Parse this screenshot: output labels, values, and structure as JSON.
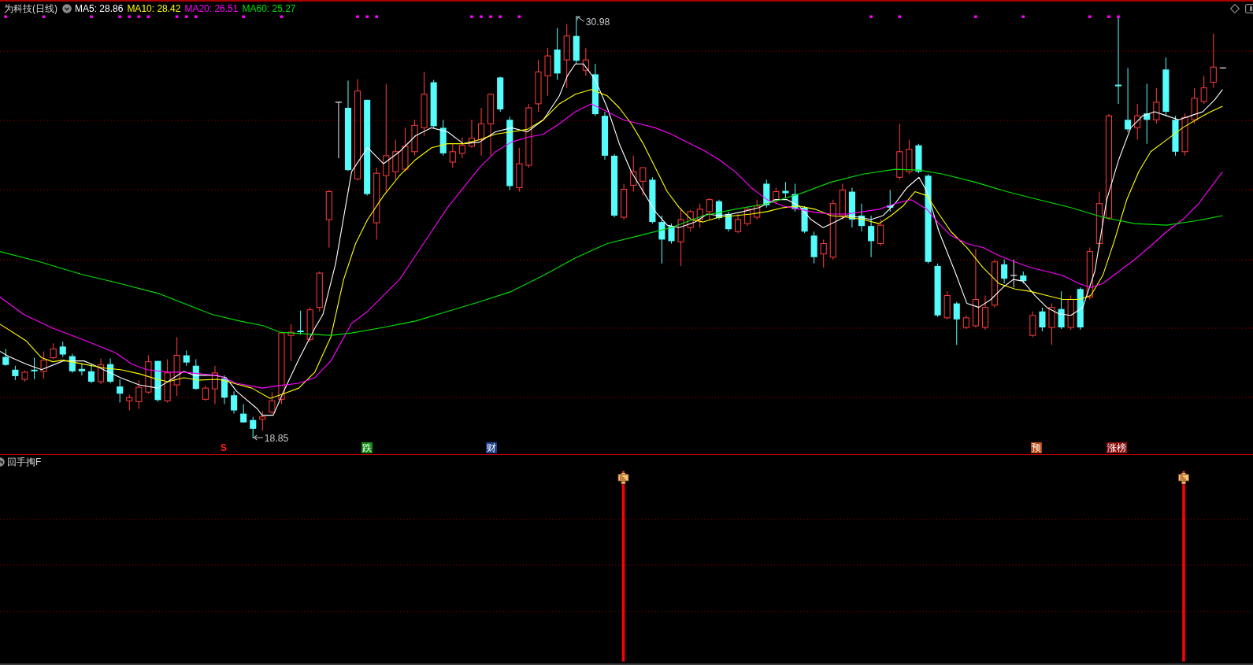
{
  "chart_header": {
    "title": "为科技(日线)",
    "indicators": [
      {
        "label": "MA5: 28.86",
        "color": "#ffffff"
      },
      {
        "label": "MA10: 28.42",
        "color": "#ffff00"
      },
      {
        "label": "MA20: 26.51",
        "color": "#ff00ff"
      },
      {
        "label": "MA60: 25.27",
        "color": "#00e000"
      }
    ]
  },
  "price_chart": {
    "high_label": "30.98",
    "low_label": "18.85",
    "signal_tags": [
      {
        "text": "S",
        "kind": "text",
        "color": "#ff2020"
      },
      {
        "text": "跌",
        "kind": "tag",
        "color": "#138a13"
      },
      {
        "text": "财",
        "kind": "tag",
        "color": "#1c3f8c"
      },
      {
        "text": "预",
        "kind": "tag",
        "color": "#b4470e"
      },
      {
        "text": "涨榜",
        "kind": "tag",
        "color": "#8c1212"
      }
    ]
  },
  "indicator_panel": {
    "title": "回手掏F"
  }
}
